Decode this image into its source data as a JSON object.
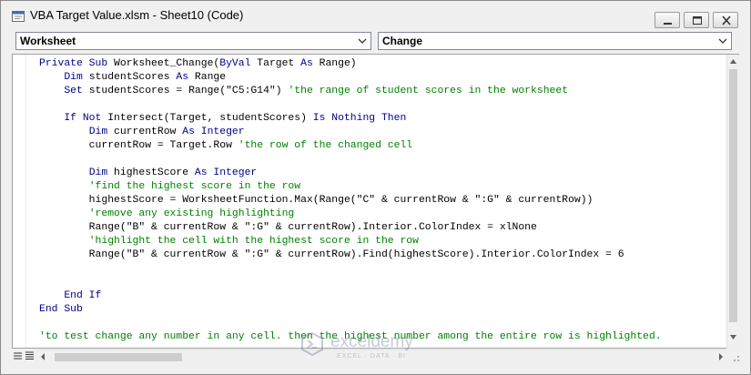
{
  "window": {
    "title": "VBA Target Value.xlsm - Sheet10 (Code)"
  },
  "titlebar_buttons": {
    "minimize_icon": "minimize-icon",
    "restore_icon": "restore-icon",
    "close_icon": "close-icon"
  },
  "object_combo": {
    "value": "Worksheet"
  },
  "procedure_combo": {
    "value": "Change"
  },
  "code_lines": [
    [
      {
        "t": "Private Sub ",
        "c": "kw"
      },
      {
        "t": "Worksheet_Change(",
        "c": ""
      },
      {
        "t": "ByVal",
        "c": "kw"
      },
      {
        "t": " Target ",
        "c": ""
      },
      {
        "t": "As",
        "c": "kw"
      },
      {
        "t": " Range)",
        "c": ""
      }
    ],
    [
      {
        "t": "    ",
        "c": ""
      },
      {
        "t": "Dim",
        "c": "kw"
      },
      {
        "t": " studentScores ",
        "c": ""
      },
      {
        "t": "As",
        "c": "kw"
      },
      {
        "t": " Range",
        "c": ""
      }
    ],
    [
      {
        "t": "    ",
        "c": ""
      },
      {
        "t": "Set",
        "c": "kw"
      },
      {
        "t": " studentScores = Range(\"C5:G14\") ",
        "c": ""
      },
      {
        "t": "'the range of student scores in the worksheet",
        "c": "cm"
      }
    ],
    [],
    [
      {
        "t": "    ",
        "c": ""
      },
      {
        "t": "If Not",
        "c": "kw"
      },
      {
        "t": " Intersect(Target, studentScores) ",
        "c": ""
      },
      {
        "t": "Is Nothing Then",
        "c": "kw"
      }
    ],
    [
      {
        "t": "        ",
        "c": ""
      },
      {
        "t": "Dim",
        "c": "kw"
      },
      {
        "t": " currentRow ",
        "c": ""
      },
      {
        "t": "As Integer",
        "c": "kw"
      }
    ],
    [
      {
        "t": "        currentRow = Target.Row ",
        "c": ""
      },
      {
        "t": "'the row of the changed cell",
        "c": "cm"
      }
    ],
    [],
    [
      {
        "t": "        ",
        "c": ""
      },
      {
        "t": "Dim",
        "c": "kw"
      },
      {
        "t": " highestScore ",
        "c": ""
      },
      {
        "t": "As Integer",
        "c": "kw"
      }
    ],
    [
      {
        "t": "        ",
        "c": ""
      },
      {
        "t": "'find the highest score in the row",
        "c": "cm"
      }
    ],
    [
      {
        "t": "        highestScore = WorksheetFunction.Max(Range(\"C\" & currentRow & \":G\" & currentRow))",
        "c": ""
      }
    ],
    [
      {
        "t": "        ",
        "c": ""
      },
      {
        "t": "'remove any existing highlighting",
        "c": "cm"
      }
    ],
    [
      {
        "t": "        Range(\"B\" & currentRow & \":G\" & currentRow).Interior.ColorIndex = xlNone",
        "c": ""
      }
    ],
    [
      {
        "t": "        ",
        "c": ""
      },
      {
        "t": "'highlight the cell with the highest score in the row",
        "c": "cm"
      }
    ],
    [
      {
        "t": "        Range(\"B\" & currentRow & \":G\" & currentRow).Find(highestScore).Interior.ColorIndex = 6",
        "c": ""
      }
    ],
    [],
    [],
    [
      {
        "t": "    ",
        "c": ""
      },
      {
        "t": "End If",
        "c": "kw"
      }
    ],
    [
      {
        "t": "End Sub",
        "c": "kw"
      }
    ],
    [],
    [
      {
        "t": "'to test change any number in any cell. then the highest number among the entire row is highlighted.",
        "c": "cm"
      }
    ]
  ],
  "colors": {
    "keyword": "#00008b",
    "comment": "#008000",
    "text": "#000000"
  },
  "watermark": {
    "name": "exceldemy",
    "tagline": "EXCEL · DATA · BI"
  }
}
